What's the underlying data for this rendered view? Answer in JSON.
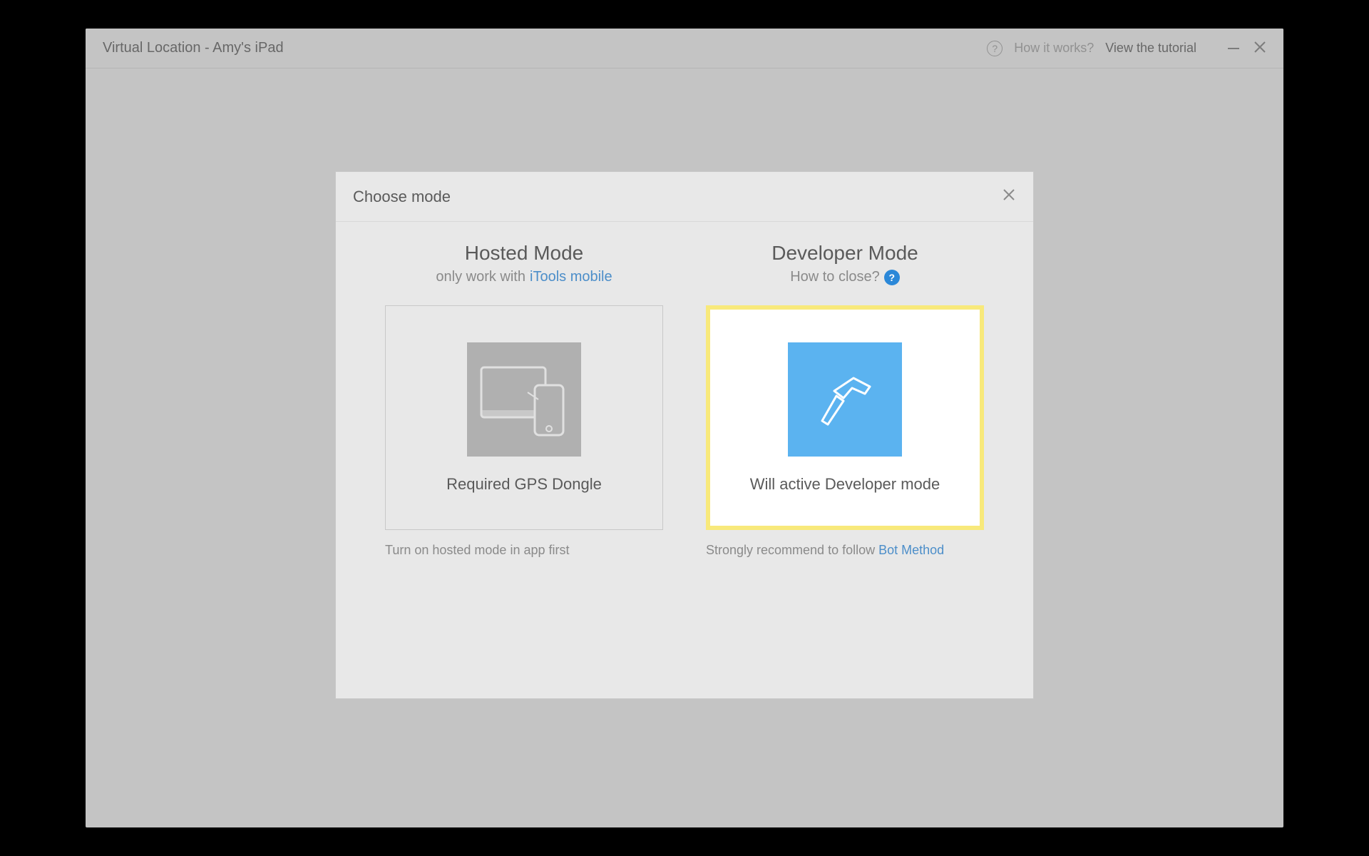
{
  "window": {
    "title": "Virtual Location - Amy's iPad",
    "how_it_works": "How it works?",
    "view_tutorial": "View the tutorial"
  },
  "dialog": {
    "title": "Choose mode",
    "hosted": {
      "heading": "Hosted Mode",
      "sub_prefix": "only work with",
      "sub_link": "iTools mobile",
      "card_label": "Required GPS Dongle",
      "footer": "Turn on hosted mode in app first"
    },
    "developer": {
      "heading": "Developer Mode",
      "sub_text": "How to close?",
      "card_label": "Will active Developer mode",
      "footer_prefix": "Strongly recommend to follow",
      "footer_link": "Bot Method"
    }
  }
}
